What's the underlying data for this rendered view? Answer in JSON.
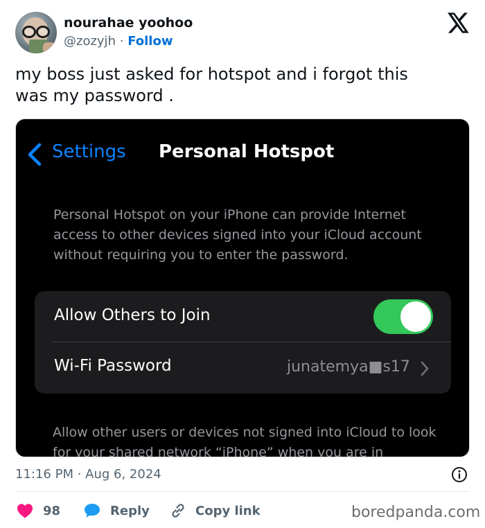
{
  "author": {
    "display_name": "nourahae yoohoo",
    "handle": "@zozyjh",
    "separator": "·",
    "follow_label": "Follow"
  },
  "tweet": {
    "text": "my boss just asked for hotspot and i forgot this\nwas my password ."
  },
  "screenshot": {
    "nav": {
      "back_label": "Settings",
      "title": "Personal Hotspot"
    },
    "intro_text": "Personal Hotspot on your iPhone can provide Internet access to other devices signed into your iCloud account without requiring you to enter the password.",
    "settings_group": {
      "allow_label": "Allow Others to Join",
      "allow_enabled": true,
      "wifi_label": "Wi-Fi Password",
      "wifi_value": "junatemya■s17"
    },
    "footer_text": "Allow other users or devices not signed into iCloud to look for your shared network “iPhone” when you are in"
  },
  "meta": {
    "timestamp": "11:16 PM · Aug 6, 2024"
  },
  "actions": {
    "like_count": "98",
    "reply_label": "Reply",
    "copy_label": "Copy link"
  },
  "watermark": "boredpanda.com",
  "colors": {
    "brand_blue": "#006fd6",
    "ios_blue": "#0a84ff",
    "ios_green": "#34c759",
    "like_red": "#f91880",
    "reply_blue": "#1d9bf0"
  },
  "icons": {
    "x_logo": "x-logo-icon",
    "back": "chevron-left-icon",
    "disclosure": "chevron-right-icon",
    "info": "info-icon",
    "like": "heart-icon",
    "reply": "speech-bubble-icon",
    "copy": "link-icon"
  }
}
